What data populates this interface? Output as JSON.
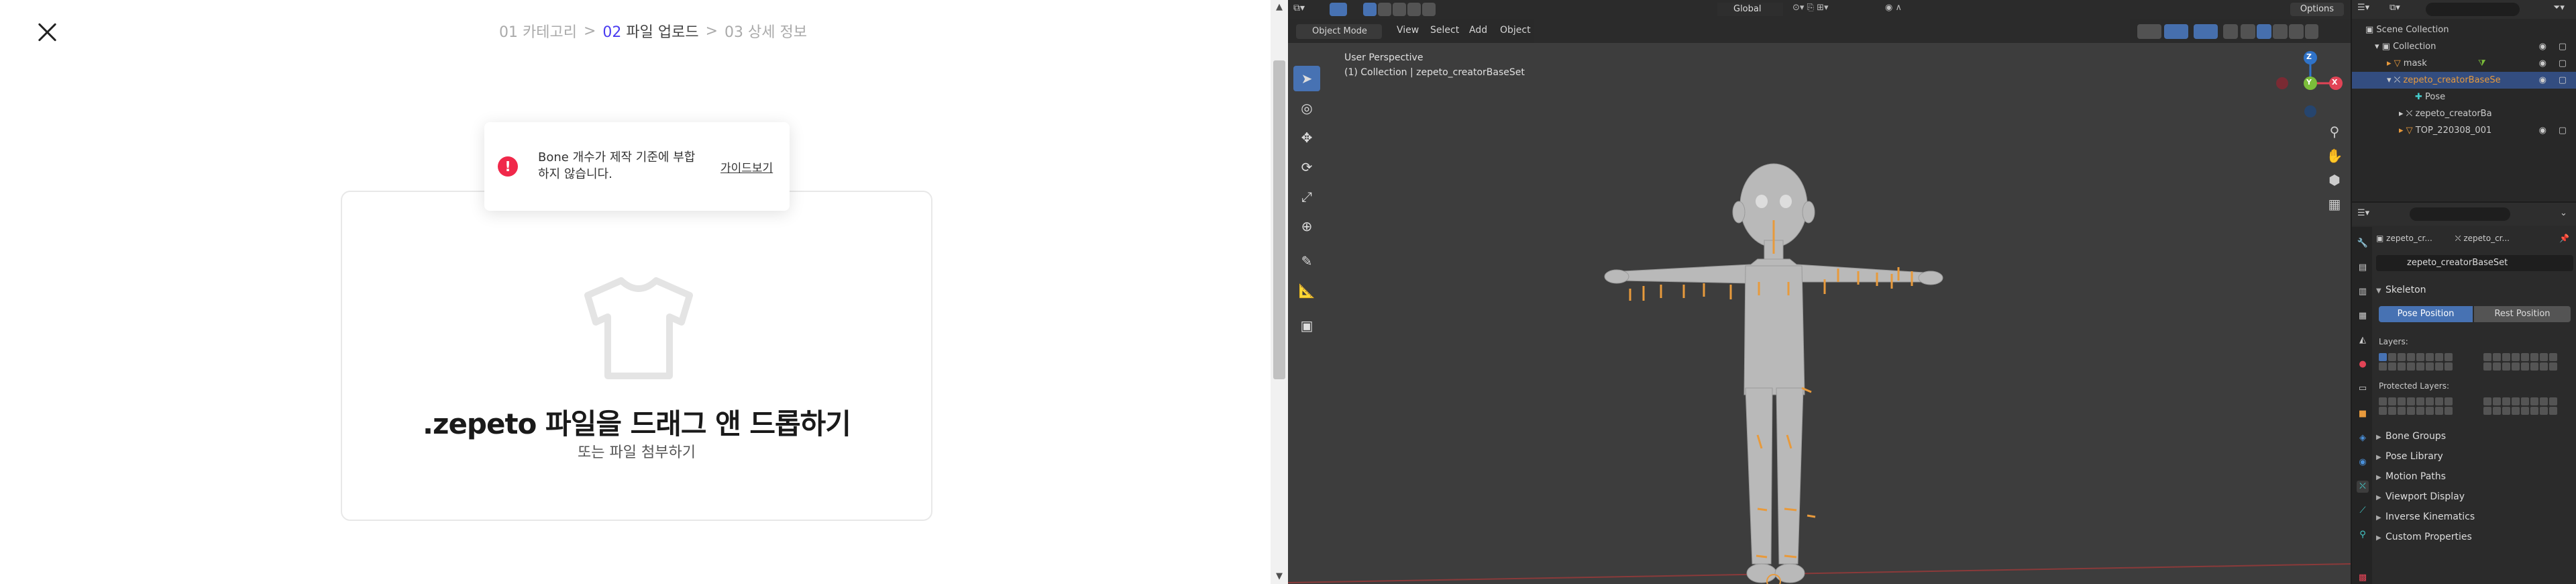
{
  "left": {
    "steps": [
      {
        "num": "01",
        "label": "카테고리"
      },
      {
        "num": "02",
        "label": "파일 업로드"
      },
      {
        "num": "03",
        "label": "상세 정보"
      }
    ],
    "step_separator": ">",
    "toast": {
      "icon": "!",
      "message": "Bone 개수가 제작 기준에 부합하지 않습니다.",
      "link": "가이드보기",
      "color": "#f0284a"
    },
    "dropzone": {
      "title": ".zepeto 파일을 드래그 앤 드롭하기",
      "subtitle": "또는 파일 첨부하기",
      "icon": "tshirt-icon"
    },
    "accent": "#4a3cf0"
  },
  "blender": {
    "topbar": {
      "orientation": "Global",
      "options": "Options"
    },
    "header_menu": {
      "mode": "Object Mode",
      "items": [
        "View",
        "Select",
        "Add",
        "Object"
      ]
    },
    "overlay": {
      "perspective": "User Perspective",
      "collection": "(1) Collection | zepeto_creatorBaseSet"
    },
    "gizmo": {
      "z": "Z",
      "x": "X",
      "y": "Y"
    },
    "outliner": {
      "rows": [
        {
          "label": "Scene Collection"
        },
        {
          "label": "Collection"
        },
        {
          "label": "mask"
        },
        {
          "label": "zepeto_creatorBaseSe"
        },
        {
          "label": "Pose"
        },
        {
          "label": "zepeto_creatorBa"
        },
        {
          "label": "TOP_220308_001"
        }
      ]
    },
    "properties": {
      "breadcrumb": [
        "zepeto_cr...",
        "zepeto_cr..."
      ],
      "datablock": "zepeto_creatorBaseSet",
      "skeleton_title": "Skeleton",
      "pose_position": "Pose Position",
      "rest_position": "Rest Position",
      "layers_label": "Layers:",
      "protected_label": "Protected Layers:",
      "panels": [
        "Bone Groups",
        "Pose Library",
        "Motion Paths",
        "Viewport Display",
        "Inverse Kinematics",
        "Custom Properties"
      ]
    },
    "colors": {
      "select_blue": "#4772b3",
      "bone_orange": "#e89a3c",
      "axis_red": "#e24456",
      "axis_green": "#7bbd3a",
      "axis_blue": "#2f73c9"
    }
  }
}
